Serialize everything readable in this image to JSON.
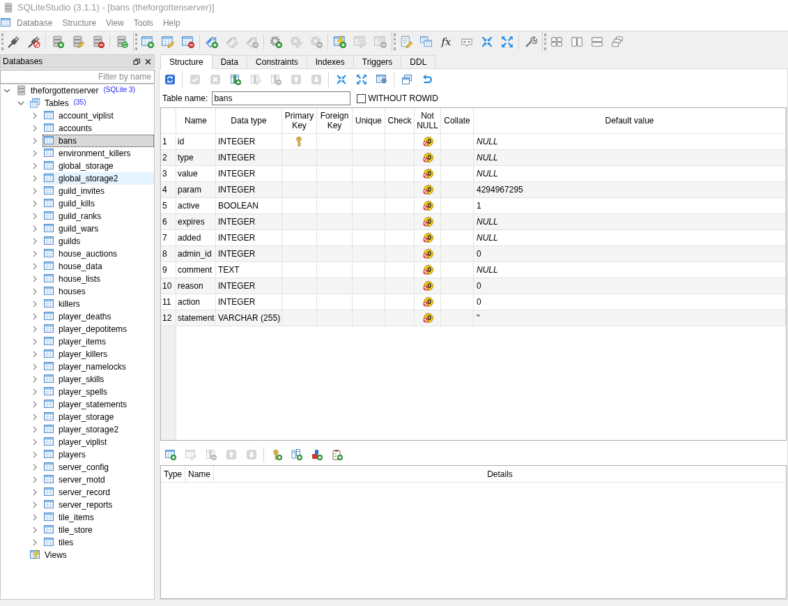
{
  "window": {
    "title": "SQLiteStudio (3.1.1) - [bans (theforgottenserver)]"
  },
  "menu_bar": [
    "Database",
    "Structure",
    "View",
    "Tools",
    "Help"
  ],
  "toolbars": [
    {
      "groups": [
        [
          {
            "disabled": false
          },
          {
            "disabled": false
          }
        ],
        [
          {
            "disabled": false
          },
          {
            "disabled": false
          },
          {
            "disabled": false
          }
        ],
        [
          {
            "disabled": false
          }
        ]
      ]
    },
    {
      "groups": [
        [
          {
            "disabled": false
          },
          {
            "disabled": false
          },
          {
            "disabled": false
          }
        ],
        [
          {
            "disabled": false
          },
          {
            "disabled": true
          },
          {
            "disabled": true
          }
        ],
        [
          {
            "disabled": false
          },
          {
            "disabled": true
          },
          {
            "disabled": true
          }
        ],
        [
          {
            "disabled": false
          },
          {
            "disabled": true
          },
          {
            "disabled": true
          }
        ]
      ]
    },
    {
      "groups": [
        [
          {
            "disabled": false
          },
          {
            "disabled": false
          },
          {
            "label": "fx",
            "disabled": false
          },
          {
            "disabled": false
          },
          {
            "disabled": false
          },
          {
            "disabled": false
          }
        ],
        [
          {
            "disabled": false
          }
        ]
      ]
    },
    {
      "groups": [
        [
          {
            "disabled": false
          },
          {
            "disabled": false
          },
          {
            "disabled": false
          },
          {
            "disabled": false
          }
        ]
      ]
    }
  ],
  "databases_panel": {
    "title": "Databases",
    "filter": {
      "placeholder": "Filter by name"
    },
    "tree": [
      {
        "kind": "database",
        "label": "theforgottenserver",
        "note": "(SQLite 3)",
        "expanded": true,
        "selected": false,
        "children": [
          {
            "kind": "folder",
            "label": "Tables",
            "note": "(35)",
            "expanded": true,
            "selected": false,
            "children": [
              {
                "kind": "table",
                "label": "account_viplist",
                "expanded": false,
                "selected": false,
                "hovered": false
              },
              {
                "kind": "table",
                "label": "accounts",
                "expanded": false,
                "selected": false,
                "hovered": false
              },
              {
                "kind": "table",
                "label": "bans",
                "expanded": false,
                "selected": true,
                "hovered": false
              },
              {
                "kind": "table",
                "label": "environment_killers",
                "expanded": false,
                "selected": false,
                "hovered": false
              },
              {
                "kind": "table",
                "label": "global_storage",
                "expanded": false,
                "selected": false,
                "hovered": false
              },
              {
                "kind": "table",
                "label": "global_storage2",
                "expanded": false,
                "selected": false,
                "hovered": true
              },
              {
                "kind": "table",
                "label": "guild_invites",
                "expanded": false,
                "selected": false,
                "hovered": false
              },
              {
                "kind": "table",
                "label": "guild_kills",
                "expanded": false,
                "selected": false,
                "hovered": false
              },
              {
                "kind": "table",
                "label": "guild_ranks",
                "expanded": false,
                "selected": false,
                "hovered": false
              },
              {
                "kind": "table",
                "label": "guild_wars",
                "expanded": false,
                "selected": false,
                "hovered": false
              },
              {
                "kind": "table",
                "label": "guilds",
                "expanded": false,
                "selected": false,
                "hovered": false
              },
              {
                "kind": "table",
                "label": "house_auctions",
                "expanded": false,
                "selected": false,
                "hovered": false
              },
              {
                "kind": "table",
                "label": "house_data",
                "expanded": false,
                "selected": false,
                "hovered": false
              },
              {
                "kind": "table",
                "label": "house_lists",
                "expanded": false,
                "selected": false,
                "hovered": false
              },
              {
                "kind": "table",
                "label": "houses",
                "expanded": false,
                "selected": false,
                "hovered": false
              },
              {
                "kind": "table",
                "label": "killers",
                "expanded": false,
                "selected": false,
                "hovered": false
              },
              {
                "kind": "table",
                "label": "player_deaths",
                "expanded": false,
                "selected": false,
                "hovered": false
              },
              {
                "kind": "table",
                "label": "player_depotitems",
                "expanded": false,
                "selected": false,
                "hovered": false
              },
              {
                "kind": "table",
                "label": "player_items",
                "expanded": false,
                "selected": false,
                "hovered": false
              },
              {
                "kind": "table",
                "label": "player_killers",
                "expanded": false,
                "selected": false,
                "hovered": false
              },
              {
                "kind": "table",
                "label": "player_namelocks",
                "expanded": false,
                "selected": false,
                "hovered": false
              },
              {
                "kind": "table",
                "label": "player_skills",
                "expanded": false,
                "selected": false,
                "hovered": false
              },
              {
                "kind": "table",
                "label": "player_spells",
                "expanded": false,
                "selected": false,
                "hovered": false
              },
              {
                "kind": "table",
                "label": "player_statements",
                "expanded": false,
                "selected": false,
                "hovered": false
              },
              {
                "kind": "table",
                "label": "player_storage",
                "expanded": false,
                "selected": false,
                "hovered": false
              },
              {
                "kind": "table",
                "label": "player_storage2",
                "expanded": false,
                "selected": false,
                "hovered": false
              },
              {
                "kind": "table",
                "label": "player_viplist",
                "expanded": false,
                "selected": false,
                "hovered": false
              },
              {
                "kind": "table",
                "label": "players",
                "expanded": false,
                "selected": false,
                "hovered": false
              },
              {
                "kind": "table",
                "label": "server_config",
                "expanded": false,
                "selected": false,
                "hovered": false
              },
              {
                "kind": "table",
                "label": "server_motd",
                "expanded": false,
                "selected": false,
                "hovered": false
              },
              {
                "kind": "table",
                "label": "server_record",
                "expanded": false,
                "selected": false,
                "hovered": false
              },
              {
                "kind": "table",
                "label": "server_reports",
                "expanded": false,
                "selected": false,
                "hovered": false
              },
              {
                "kind": "table",
                "label": "tile_items",
                "expanded": false,
                "selected": false,
                "hovered": false
              },
              {
                "kind": "table",
                "label": "tile_store",
                "expanded": false,
                "selected": false,
                "hovered": false
              },
              {
                "kind": "table",
                "label": "tiles",
                "expanded": false,
                "selected": false,
                "hovered": false
              }
            ]
          },
          {
            "kind": "views",
            "label": "Views",
            "selected": false
          }
        ]
      }
    ]
  },
  "editor": {
    "tabs": [
      {
        "label": "Structure",
        "selected": true
      },
      {
        "label": "Data",
        "selected": false
      },
      {
        "label": "Constraints",
        "selected": false
      },
      {
        "label": "Indexes",
        "selected": false
      },
      {
        "label": "Triggers",
        "selected": false
      },
      {
        "label": "DDL",
        "selected": false
      }
    ],
    "toolbar": {
      "groups": [
        [
          {
            "disabled": false
          }
        ],
        [
          {
            "disabled": true
          },
          {
            "disabled": true
          },
          {
            "disabled": false
          },
          {
            "disabled": true
          },
          {
            "disabled": true
          },
          {
            "disabled": true
          },
          {
            "disabled": true
          }
        ],
        [
          {
            "disabled": false
          },
          {
            "disabled": false
          },
          {
            "disabled": false
          }
        ],
        [
          {
            "disabled": false
          },
          {
            "disabled": false
          }
        ]
      ]
    },
    "table_name": {
      "label": "Table name:",
      "value": "bans"
    },
    "without_rowid": {
      "label": "WITHOUT ROWID",
      "checked": false
    },
    "structure_grid": {
      "columns": [
        "Name",
        "Data type",
        "Primary Key",
        "Foreign Key",
        "Unique",
        "Check",
        "Not NULL",
        "Collate",
        "Default value"
      ],
      "rows": [
        {
          "number": "1",
          "name": "id",
          "data_type": "INTEGER",
          "primary_key": true,
          "not_null": true,
          "default": {
            "text": "NULL",
            "kind": "null"
          }
        },
        {
          "number": "2",
          "name": "type",
          "data_type": "INTEGER",
          "primary_key": false,
          "not_null": true,
          "default": {
            "text": "NULL",
            "kind": "null"
          }
        },
        {
          "number": "3",
          "name": "value",
          "data_type": "INTEGER",
          "primary_key": false,
          "not_null": true,
          "default": {
            "text": "NULL",
            "kind": "null"
          }
        },
        {
          "number": "4",
          "name": "param",
          "data_type": "INTEGER",
          "primary_key": false,
          "not_null": true,
          "default": {
            "text": "4294967295",
            "kind": "literal"
          }
        },
        {
          "number": "5",
          "name": "active",
          "data_type": "BOOLEAN",
          "primary_key": false,
          "not_null": true,
          "default": {
            "text": "1",
            "kind": "literal"
          }
        },
        {
          "number": "6",
          "name": "expires",
          "data_type": "INTEGER",
          "primary_key": false,
          "not_null": true,
          "default": {
            "text": "NULL",
            "kind": "null"
          }
        },
        {
          "number": "7",
          "name": "added",
          "data_type": "INTEGER",
          "primary_key": false,
          "not_null": true,
          "default": {
            "text": "NULL",
            "kind": "null"
          }
        },
        {
          "number": "8",
          "name": "admin_id",
          "data_type": "INTEGER",
          "primary_key": false,
          "not_null": true,
          "default": {
            "text": "0",
            "kind": "literal"
          }
        },
        {
          "number": "9",
          "name": "comment",
          "data_type": "TEXT",
          "primary_key": false,
          "not_null": true,
          "default": {
            "text": "NULL",
            "kind": "null"
          }
        },
        {
          "number": "10",
          "name": "reason",
          "data_type": "INTEGER",
          "primary_key": false,
          "not_null": true,
          "default": {
            "text": "0",
            "kind": "literal"
          }
        },
        {
          "number": "11",
          "name": "action",
          "data_type": "INTEGER",
          "primary_key": false,
          "not_null": true,
          "default": {
            "text": "0",
            "kind": "literal"
          }
        },
        {
          "number": "12",
          "name": "statement",
          "data_type": "VARCHAR (255)",
          "primary_key": false,
          "not_null": true,
          "default": {
            "text": "''",
            "kind": "literal"
          }
        }
      ]
    },
    "constraints_toolbar": {
      "groups": [
        [
          {
            "disabled": false
          },
          {
            "disabled": true
          },
          {
            "disabled": true
          },
          {
            "disabled": true
          },
          {
            "disabled": true
          }
        ],
        [
          {
            "disabled": false
          },
          {
            "disabled": false
          },
          {
            "disabled": false
          },
          {
            "disabled": false
          }
        ]
      ]
    },
    "constraints_grid": {
      "columns": [
        "Type",
        "Name",
        "Details"
      ]
    }
  }
}
